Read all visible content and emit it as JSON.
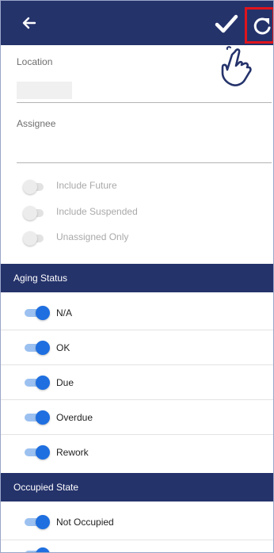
{
  "filters": {
    "location": {
      "label": "Location",
      "value": ""
    },
    "assignee": {
      "label": "Assignee",
      "value": ""
    },
    "options": [
      {
        "label": "Include Future",
        "enabled": false
      },
      {
        "label": "Include Suspended",
        "enabled": false
      },
      {
        "label": "Unassigned Only",
        "enabled": false
      }
    ]
  },
  "aging_status": {
    "title": "Aging Status",
    "items": [
      {
        "label": "N/A",
        "enabled": true
      },
      {
        "label": "OK",
        "enabled": true
      },
      {
        "label": "Due",
        "enabled": true
      },
      {
        "label": "Overdue",
        "enabled": true
      },
      {
        "label": "Rework",
        "enabled": true
      }
    ]
  },
  "occupied_state": {
    "title": "Occupied State",
    "items": [
      {
        "label": "Not Occupied",
        "enabled": true
      }
    ]
  },
  "icons": {
    "back": "arrow-left-icon",
    "apply": "checkmark-icon",
    "reset": "refresh-icon",
    "pointer": "pointing-hand-icon"
  },
  "colors": {
    "app_bar": "#25336b",
    "toggle_on": "#1f6fe0",
    "highlight": "#e0141c"
  }
}
